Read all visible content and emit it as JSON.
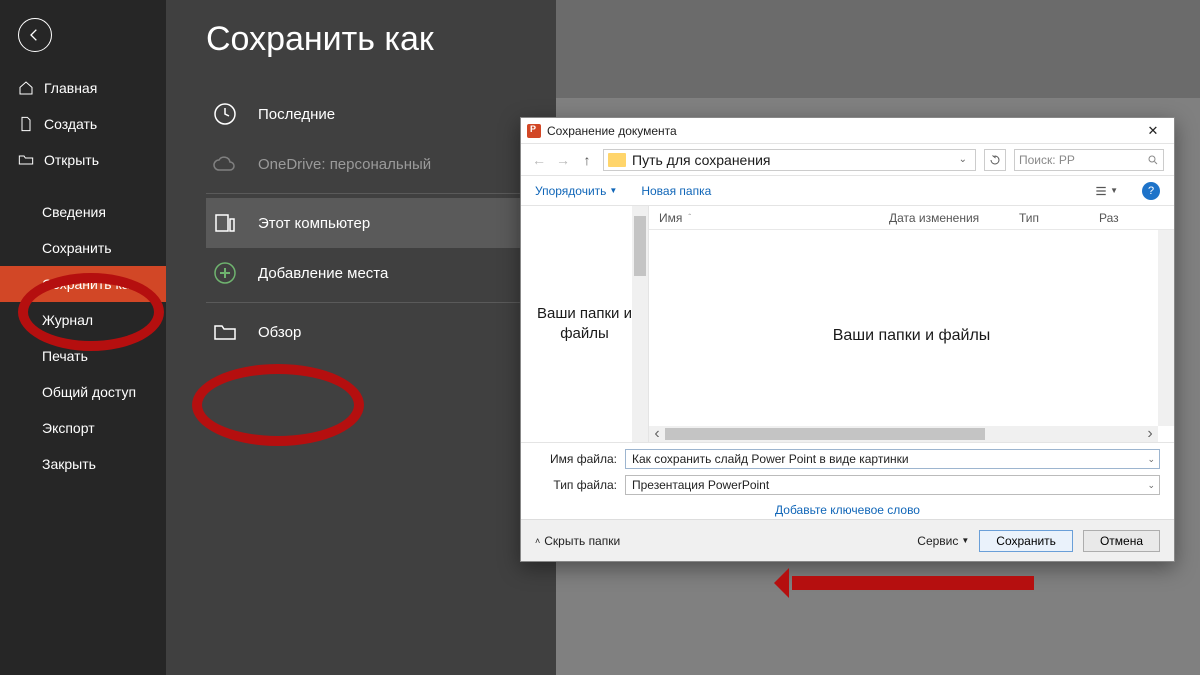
{
  "sidebar": {
    "items": [
      {
        "label": "Главная"
      },
      {
        "label": "Создать"
      },
      {
        "label": "Открыть"
      },
      {
        "label": "Сведения"
      },
      {
        "label": "Сохранить"
      },
      {
        "label": "Сохранить как"
      },
      {
        "label": "Журнал"
      },
      {
        "label": "Печать"
      },
      {
        "label": "Общий доступ"
      },
      {
        "label": "Экспорт"
      },
      {
        "label": "Закрыть"
      }
    ]
  },
  "stage": {
    "title": "Сохранить как",
    "locations": {
      "recent": "Последние",
      "onedrive_l1": "OneDrive: персональный",
      "onedrive_l2": "",
      "this_pc": "Этот компьютер",
      "add_place": "Добавление места",
      "browse": "Обзор"
    }
  },
  "dialog": {
    "title": "Сохранение документа",
    "path_overlay": "Путь для сохранения",
    "search_placeholder": "Поиск: PP",
    "toolbar": {
      "organize": "Упорядочить",
      "new_folder": "Новая папка"
    },
    "columns": {
      "name": "Имя",
      "date": "Дата изменения",
      "type": "Тип",
      "size": "Раз"
    },
    "tree_overlay": "Ваши папки и файлы",
    "list_overlay": "Ваши папки и файлы",
    "fields": {
      "name_label": "Имя файла:",
      "name_value": "Как сохранить слайд Power Point в виде картинки",
      "type_label": "Тип файла:",
      "type_value": "Презентация PowerPoint",
      "tags": "Добавьте ключевое слово"
    },
    "footer": {
      "collapse": "Скрыть папки",
      "service": "Сервис",
      "save": "Сохранить",
      "cancel": "Отмена"
    }
  }
}
